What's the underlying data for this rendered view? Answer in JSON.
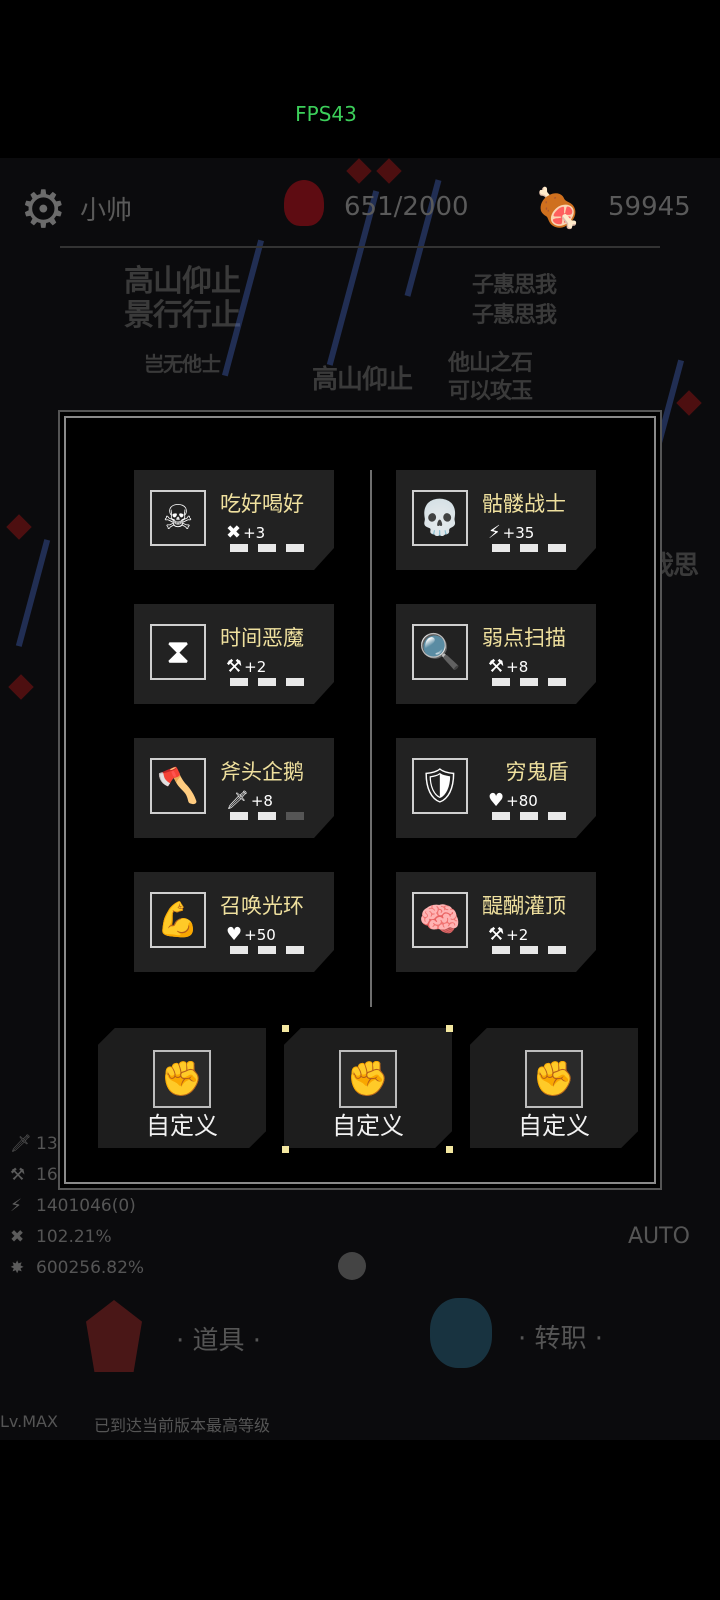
{
  "hud": {
    "fps": "FPS43",
    "player_name": "小帅",
    "hp": "651/2000",
    "coins": "59945",
    "auto": "AUTO"
  },
  "background_text": [
    "高山仰止",
    "景行行止",
    "子惠思我",
    "子惠思我",
    "岂无他士",
    "他山之石",
    "可以攻玉",
    "高山仰止",
    "我思"
  ],
  "stats": [
    "13",
    "16",
    "1401046(0)",
    "102.21%",
    "600256.82%"
  ],
  "bottom_nav": {
    "items": "· 道具 ·",
    "job": "· 转职 ·"
  },
  "level": {
    "lv": "Lv.MAX",
    "message": "已到达当前版本最高等级"
  },
  "skills": [
    {
      "name": "吃好喝好",
      "icon": "fishbone-icon",
      "bonus_icon": "crit-icon",
      "bonus": "+3",
      "pips": [
        1,
        1,
        1
      ]
    },
    {
      "name": "骷髅战士",
      "icon": "skull-icon",
      "bonus_icon": "claw-icon",
      "bonus": "+35",
      "pips": [
        1,
        1,
        1
      ]
    },
    {
      "name": "时间恶魔",
      "icon": "hourglass-icon",
      "bonus_icon": "axe-icon",
      "bonus": "+2",
      "pips": [
        1,
        1,
        1
      ]
    },
    {
      "name": "弱点扫描",
      "icon": "magnifier-icon",
      "bonus_icon": "axe-icon",
      "bonus": "+8",
      "pips": [
        1,
        1,
        1
      ]
    },
    {
      "name": "斧头企鹅",
      "icon": "axe-penguin-icon",
      "bonus_icon": "sword-icon",
      "bonus": "+8",
      "pips": [
        1,
        1,
        0
      ]
    },
    {
      "name": "穷鬼盾",
      "icon": "shield-icon",
      "bonus_icon": "heart-icon",
      "bonus": "+80",
      "pips": [
        1,
        1,
        1
      ]
    },
    {
      "name": "召唤光环",
      "icon": "strongman-icon",
      "bonus_icon": "heart-icon",
      "bonus": "+50",
      "pips": [
        1,
        1,
        1
      ]
    },
    {
      "name": "醍醐灌顶",
      "icon": "brain-icon",
      "bonus_icon": "axe-icon",
      "bonus": "+2",
      "pips": [
        1,
        1,
        1
      ]
    }
  ],
  "custom_slots": [
    "自定义",
    "自定义",
    "自定义"
  ]
}
